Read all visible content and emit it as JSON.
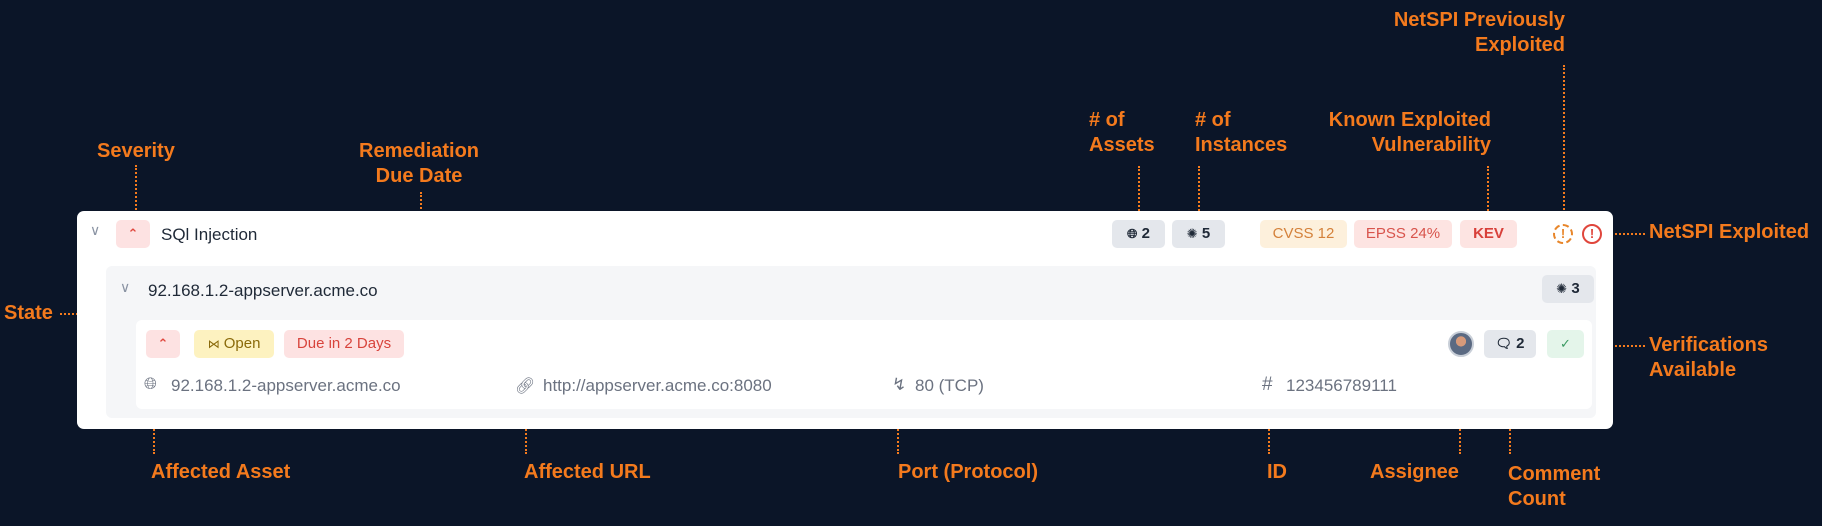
{
  "annotations": {
    "severity": "Severity",
    "remediation_due_date": "Remediation\nDue Date",
    "num_assets": "# of\nAssets",
    "num_instances": "# of\nInstances",
    "known_exploited": "Known Exploited\nVulnerability",
    "netspi_previously_exploited": "NetSPI Previously\nExploited",
    "netspi_exploited": "NetSPI Exploited",
    "state": "State",
    "verifications_available": "Verifications\nAvailable",
    "affected_asset": "Affected Asset",
    "affected_url": "Affected URL",
    "port_protocol": "Port (Protocol)",
    "id": "ID",
    "assignee": "Assignee",
    "comment_count": "Comment\nCount"
  },
  "finding": {
    "title": "SQl Injection",
    "assets_count": "2",
    "instances_count": "5",
    "cvss": "CVSS 12",
    "epss": "EPSS 24%",
    "kev": "KEV",
    "previously_exploited_glyph": "!",
    "exploited_glyph": "!"
  },
  "asset_group": {
    "name": "92.168.1.2-appserver.acme.co",
    "instances_count": "3"
  },
  "instance": {
    "state": "Open",
    "due": "Due in 2 Days",
    "comment_count": "2",
    "asset": "92.168.1.2-appserver.acme.co",
    "url": "http://appserver.acme.co:8080",
    "port": "80 (TCP)",
    "id": "123456789111"
  },
  "colors": {
    "background": "#0b1528",
    "annotation": "#f47a1d"
  }
}
